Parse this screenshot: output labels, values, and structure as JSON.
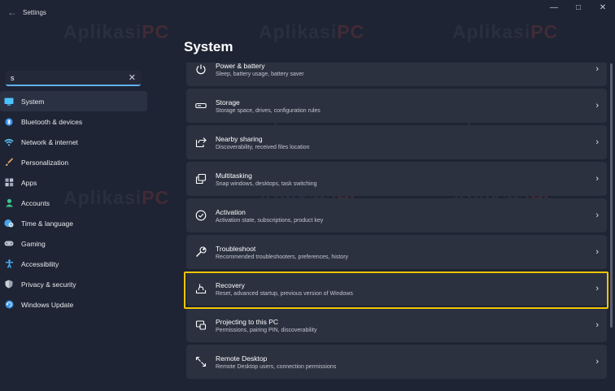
{
  "window": {
    "title": "Settings",
    "back_icon": "back-arrow-icon",
    "controls": [
      "minimize-icon",
      "maximize-icon",
      "close-icon"
    ]
  },
  "watermark": {
    "text": "Aplikasi",
    "suffix": "PC"
  },
  "search": {
    "value": "s"
  },
  "sidebar": {
    "items": [
      {
        "label": "System",
        "icon": "monitor-icon",
        "active": true
      },
      {
        "label": "Bluetooth & devices",
        "icon": "bluetooth-icon"
      },
      {
        "label": "Network & internet",
        "icon": "wifi-icon"
      },
      {
        "label": "Personalization",
        "icon": "brush-icon"
      },
      {
        "label": "Apps",
        "icon": "apps-icon"
      },
      {
        "label": "Accounts",
        "icon": "person-icon"
      },
      {
        "label": "Time & language",
        "icon": "globe-clock-icon"
      },
      {
        "label": "Gaming",
        "icon": "gamepad-icon"
      },
      {
        "label": "Accessibility",
        "icon": "accessibility-icon"
      },
      {
        "label": "Privacy & security",
        "icon": "shield-icon"
      },
      {
        "label": "Windows Update",
        "icon": "update-icon"
      }
    ]
  },
  "main": {
    "title": "System",
    "items": [
      {
        "title": "Power & battery",
        "desc": "Sleep, battery usage, battery saver",
        "icon": "power-icon"
      },
      {
        "title": "Storage",
        "desc": "Storage space, drives, configuration rules",
        "icon": "storage-icon"
      },
      {
        "title": "Nearby sharing",
        "desc": "Discoverability, received files location",
        "icon": "share-icon"
      },
      {
        "title": "Multitasking",
        "desc": "Snap windows, desktops, task switching",
        "icon": "multitasking-icon"
      },
      {
        "title": "Activation",
        "desc": "Activation state, subscriptions, product key",
        "icon": "check-circle-icon"
      },
      {
        "title": "Troubleshoot",
        "desc": "Recommended troubleshooters, preferences, history",
        "icon": "wrench-icon"
      },
      {
        "title": "Recovery",
        "desc": "Reset, advanced startup, previous version of Windows",
        "icon": "recovery-icon",
        "highlighted": true
      },
      {
        "title": "Projecting to this PC",
        "desc": "Permissions, pairing PIN, discoverability",
        "icon": "projecting-icon"
      },
      {
        "title": "Remote Desktop",
        "desc": "Remote Desktop users, connection permissions",
        "icon": "remote-desktop-icon"
      }
    ]
  },
  "colors": {
    "accent": "#5fb2f2",
    "highlight": "#f2c400",
    "background": "#1e2433",
    "card": "#2b313f"
  }
}
